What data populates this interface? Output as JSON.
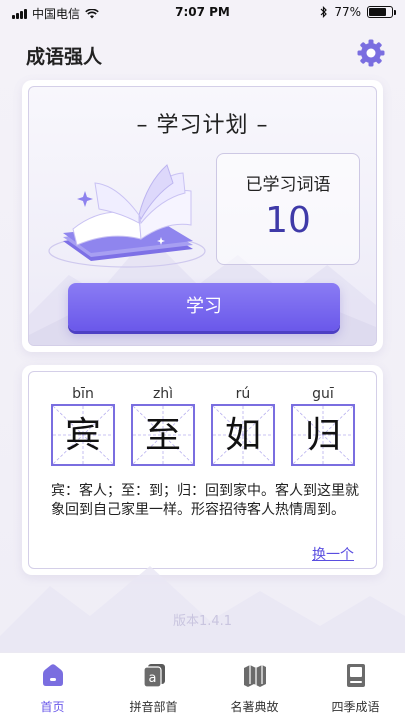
{
  "status_bar": {
    "carrier": "中国电信",
    "time": "7:07 PM",
    "battery": "77%",
    "battery_level": 0.77
  },
  "header": {
    "title": "成语强人",
    "settings_icon": "gear-icon"
  },
  "plan_card": {
    "title": "– 学习计划 –",
    "learned_label": "已学习词语",
    "learned_count": "10",
    "study_button": "学习"
  },
  "idiom": {
    "chars": [
      {
        "pinyin": "bīn",
        "char": "宾"
      },
      {
        "pinyin": "zhì",
        "char": "至"
      },
      {
        "pinyin": "rú",
        "char": "如"
      },
      {
        "pinyin": "guī",
        "char": "归"
      }
    ],
    "meaning": "宾：客人；至：到；归：回到家中。客人到这里就象回到自己家里一样。形容招待客人热情周到。",
    "change_link": "换一个"
  },
  "version": "版本1.4.1",
  "tabs": [
    {
      "label": "首页",
      "icon": "home-icon",
      "active": true
    },
    {
      "label": "拼音部首",
      "icon": "pinyin-icon",
      "active": false
    },
    {
      "label": "名著典故",
      "icon": "map-book-icon",
      "active": false
    },
    {
      "label": "四季成语",
      "icon": "book-icon",
      "active": false
    }
  ],
  "colors": {
    "accent": "#6a58ea",
    "count_text": "#3f3aa8",
    "grid_border": "#7a6ee0"
  }
}
